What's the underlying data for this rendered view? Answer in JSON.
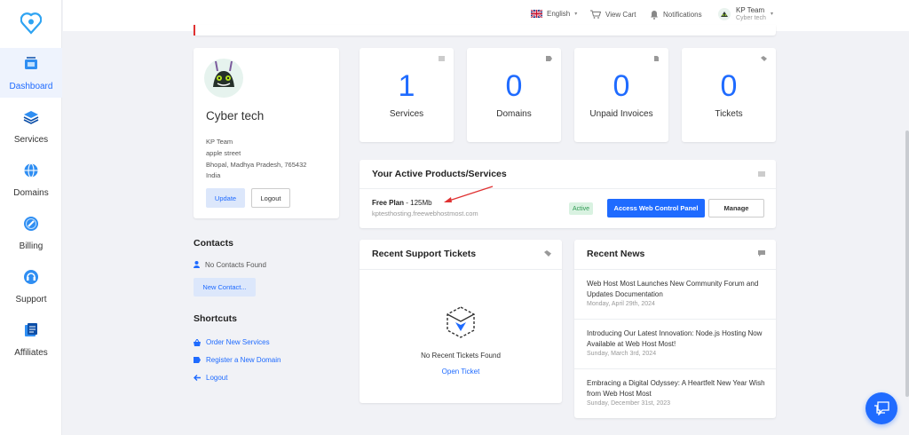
{
  "sidebar": {
    "items": [
      {
        "label": "Dashboard",
        "icon": "dashboard-icon"
      },
      {
        "label": "Services",
        "icon": "services-icon"
      },
      {
        "label": "Domains",
        "icon": "domains-icon"
      },
      {
        "label": "Billing",
        "icon": "billing-icon"
      },
      {
        "label": "Support",
        "icon": "support-icon"
      },
      {
        "label": "Affiliates",
        "icon": "affiliates-icon"
      }
    ]
  },
  "topbar": {
    "language": "English",
    "view_cart": "View Cart",
    "notifications": "Notifications",
    "user_name": "KP Team",
    "user_company": "Cyber tech"
  },
  "profile": {
    "company": "Cyber tech",
    "name": "KP Team",
    "street": "apple street",
    "city_line": "Bhopal, Madhya Pradesh, 765432",
    "country": "India",
    "update_label": "Update",
    "logout_label": "Logout"
  },
  "contacts": {
    "title": "Contacts",
    "empty": "No Contacts Found",
    "new_label": "New Contact..."
  },
  "shortcuts": {
    "title": "Shortcuts",
    "items": [
      "Order New Services",
      "Register a New Domain",
      "Logout"
    ]
  },
  "stats": [
    {
      "value": "1",
      "label": "Services"
    },
    {
      "value": "0",
      "label": "Domains"
    },
    {
      "value": "0",
      "label": "Unpaid Invoices"
    },
    {
      "value": "0",
      "label": "Tickets"
    }
  ],
  "products": {
    "title": "Your Active Products/Services",
    "plan_name": "Free Plan",
    "plan_size": " - 125Mb",
    "domain": "kptesthosting.freewebhostmost.com",
    "status": "Active",
    "access_label": "Access Web Control Panel",
    "manage_label": "Manage"
  },
  "tickets": {
    "title": "Recent Support Tickets",
    "empty": "No Recent Tickets Found",
    "open_label": "Open Ticket"
  },
  "news": {
    "title": "Recent News",
    "items": [
      {
        "title": "Web Host Most Launches New Community Forum and Updates Documentation",
        "date": "Monday, April 29th, 2024"
      },
      {
        "title": "Introducing Our Latest Innovation: Node.js Hosting Now Available at Web Host Most!",
        "date": "Sunday, March 3rd, 2024"
      },
      {
        "title": "Embracing a Digital Odyssey: A Heartfelt New Year Wish from Web Host Most",
        "date": "Sunday, December 31st, 2023"
      }
    ]
  },
  "colors": {
    "accent": "#1f6bff",
    "status_active": "#2e9a52"
  }
}
